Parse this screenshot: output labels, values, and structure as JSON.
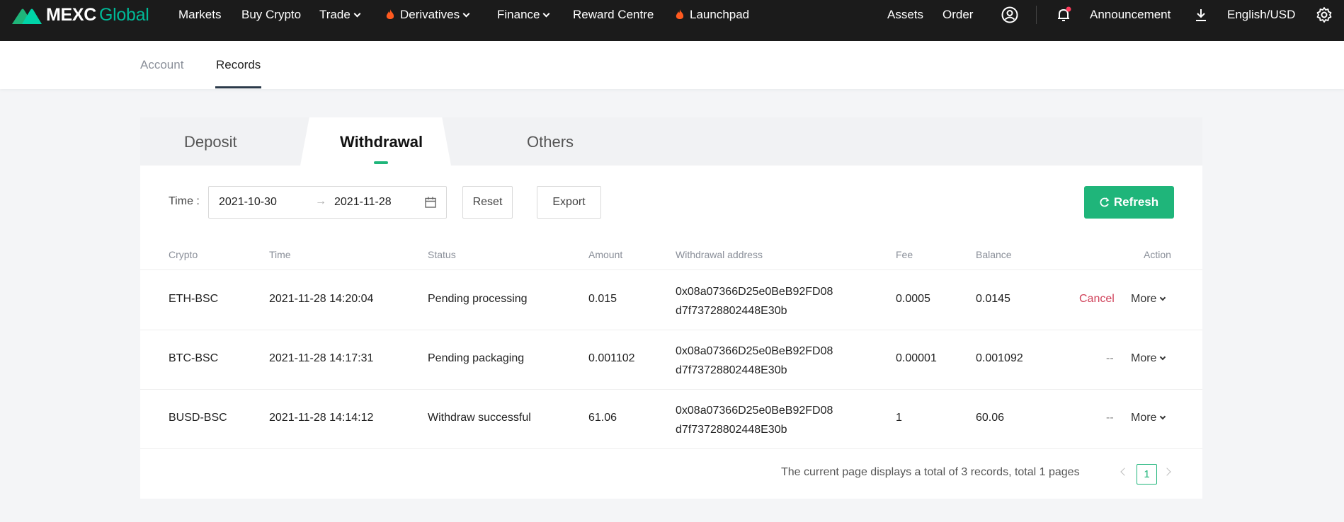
{
  "nav": {
    "logo_part1": "MEXC",
    "logo_part2": "Global",
    "items": [
      {
        "label": "Markets"
      },
      {
        "label": "Buy Crypto"
      },
      {
        "label": "Trade"
      },
      {
        "label": "Derivatives"
      },
      {
        "label": "Finance"
      },
      {
        "label": "Reward Centre"
      },
      {
        "label": "Launchpad"
      }
    ],
    "right": {
      "assets": "Assets",
      "order": "Order",
      "announcement": "Announcement",
      "language": "English/USD"
    },
    "colors": {
      "brand": "#00b897",
      "flame": "#ff5a1f",
      "notification_dot": "#ff3b5c"
    }
  },
  "subheader": {
    "tabs": [
      {
        "label": "Account",
        "active": false
      },
      {
        "label": "Records",
        "active": true
      }
    ]
  },
  "records": {
    "tabs": [
      {
        "label": "Deposit",
        "active": false
      },
      {
        "label": "Withdrawal",
        "active": true
      },
      {
        "label": "Others",
        "active": false
      }
    ],
    "filter": {
      "time_label": "Time :",
      "start_date": "2021-10-30",
      "end_date": "2021-11-28",
      "arrow": "→",
      "reset_label": "Reset",
      "export_label": "Export",
      "refresh_label": "Refresh"
    },
    "columns": [
      "Crypto",
      "Time",
      "Status",
      "Amount",
      "Withdrawal address",
      "Fee",
      "Balance",
      "Action"
    ],
    "rows": [
      {
        "crypto": "ETH-BSC",
        "time": "2021-11-28 14:20:04",
        "status": "Pending processing",
        "amount": "0.015",
        "address_line1": "0x08a07366D25e0BeB92FD08",
        "address_line2": "d7f73728802448E30b",
        "fee": "0.0005",
        "balance": "0.0145",
        "action_primary": "Cancel",
        "action_more": "More"
      },
      {
        "crypto": "BTC-BSC",
        "time": "2021-11-28 14:17:31",
        "status": "Pending packaging",
        "amount": "0.001102",
        "address_line1": "0x08a07366D25e0BeB92FD08",
        "address_line2": "d7f73728802448E30b",
        "fee": "0.00001",
        "balance": "0.001092",
        "action_primary": "--",
        "action_more": "More"
      },
      {
        "crypto": "BUSD-BSC",
        "time": "2021-11-28 14:14:12",
        "status": "Withdraw successful",
        "amount": "61.06",
        "address_line1": "0x08a07366D25e0BeB92FD08",
        "address_line2": "d7f73728802448E30b",
        "fee": "1",
        "balance": "60.06",
        "action_primary": "--",
        "action_more": "More"
      }
    ],
    "pagination": {
      "info": "The current page displays a total of 3 records, total 1 pages",
      "current_page": "1"
    },
    "colors": {
      "accent": "#1fb57a",
      "cancel": "#d0425a"
    }
  }
}
